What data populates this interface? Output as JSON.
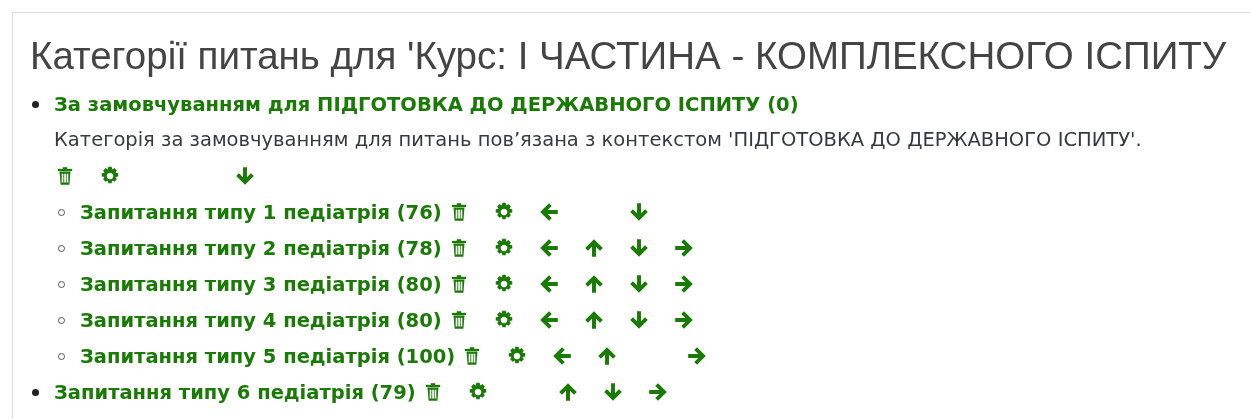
{
  "title": "Категорії питань для 'Курс: І ЧАСТИНА - КОМПЛЕКСНОГО ІСПИТУ",
  "categories": [
    {
      "name": "За замовчуванням для ПІДГОТОВКА ДО ДЕРЖАВНОГО ІСПИТУ (0)",
      "description": "Категорія за замовчуванням для питань пов’язана з контекстом 'ПІДГОТОВКА ДО ДЕРЖАВНОГО ІСПИТУ'.",
      "actions": {
        "delete": true,
        "settings": true,
        "left": false,
        "up": false,
        "down": true,
        "right": false
      },
      "children": [
        {
          "name": "Запитання типу 1 педіатрія (76)",
          "actions": {
            "delete": true,
            "settings": true,
            "left": true,
            "up": false,
            "down": true,
            "right": false
          }
        },
        {
          "name": "Запитання типу 2 педіатрія (78)",
          "actions": {
            "delete": true,
            "settings": true,
            "left": true,
            "up": true,
            "down": true,
            "right": true
          }
        },
        {
          "name": "Запитання типу 3 педіатрія (80)",
          "actions": {
            "delete": true,
            "settings": true,
            "left": true,
            "up": true,
            "down": true,
            "right": true
          }
        },
        {
          "name": "Запитання типу 4 педіатрія (80)",
          "actions": {
            "delete": true,
            "settings": true,
            "left": true,
            "up": true,
            "down": true,
            "right": true
          }
        },
        {
          "name": "Запитання типу 5 педіатрія (100)",
          "actions": {
            "delete": true,
            "settings": true,
            "left": true,
            "up": true,
            "down": false,
            "right": true
          }
        }
      ]
    },
    {
      "name": "Запитання типу 6 педіатрія (79)",
      "actions": {
        "delete": true,
        "settings": true,
        "left": false,
        "up": true,
        "down": true,
        "right": true
      }
    }
  ]
}
